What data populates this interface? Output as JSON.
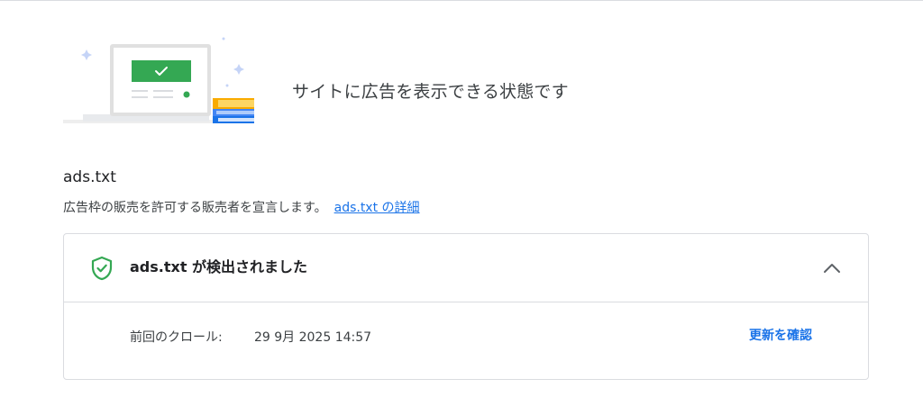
{
  "status": {
    "title": "サイトに広告を表示できる状態です"
  },
  "section": {
    "title": "ads.txt",
    "description": "広告枠の販売を許可する販売者を宣言します。",
    "link_label": "ads.txt の詳細"
  },
  "card": {
    "title": "ads.txt が検出されました",
    "crawl_label": "前回のクロール:",
    "crawl_value": "29 9月 2025 14:57",
    "check_update_label": "更新を確認",
    "expanded": true
  },
  "colors": {
    "accent": "#1a73e8",
    "success": "#34a853",
    "border": "#dadce0"
  },
  "icons": {
    "status": "shield-check-icon",
    "toggle": "chevron-up-icon",
    "illustration": "monitor-check-illustration"
  }
}
